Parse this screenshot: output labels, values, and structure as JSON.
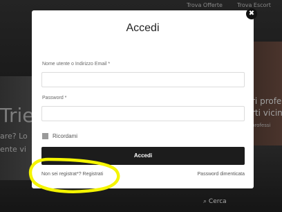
{
  "background": {
    "top_links": [
      "Trova Offerte",
      "Trova Escort"
    ],
    "hero_fragment": "Trie",
    "left_lines": [
      "are? Lo",
      "ente vi"
    ],
    "right_lines": [
      "ri profe",
      "rti vicin"
    ],
    "right_small": "professi",
    "search_label": "Cerca"
  },
  "modal": {
    "title": "Accedi",
    "username_label": "Nome utente o Indirizzo Email *",
    "username_value": "",
    "password_label": "Password *",
    "password_value": "",
    "remember_label": "Ricordami",
    "submit_label": "Accedi",
    "register_link": "Non sei registrat*? Registrati",
    "forgot_link": "Password dimenticata",
    "close_glyph": "✖"
  },
  "annotation": {
    "color": "#f5f500"
  }
}
